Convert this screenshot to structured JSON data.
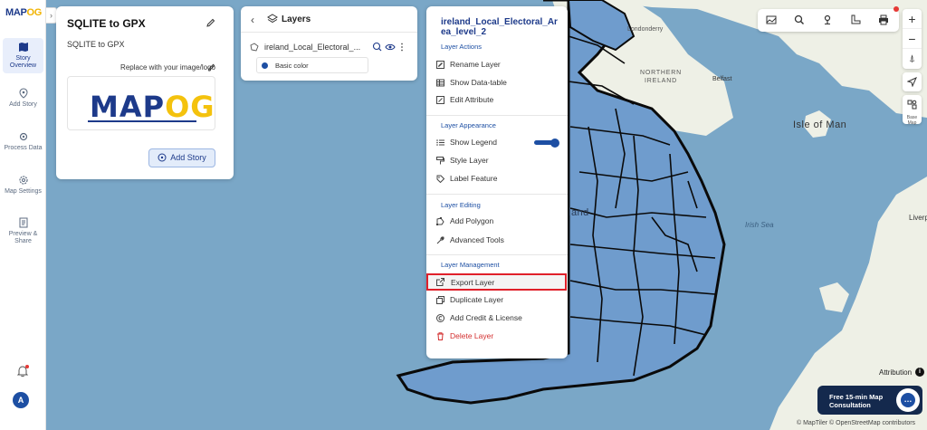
{
  "brand": {
    "logo_map": "MAP",
    "logo_og": "OG"
  },
  "nav": {
    "items": [
      {
        "label": "Story Overview",
        "icon": "map-icon"
      },
      {
        "label": "Add Story",
        "icon": "location-pin-icon"
      },
      {
        "label": "Process Data",
        "icon": "process-gear-icon"
      },
      {
        "label": "Map Settings",
        "icon": "settings-gear-icon"
      },
      {
        "label": "Preview & Share",
        "icon": "preview-icon"
      }
    ],
    "avatar_initial": "A"
  },
  "story": {
    "title": "SQLITE to GPX",
    "subtitle": "SQLITE to GPX",
    "replace_label": "Replace with your image/logo",
    "logo_map": "MAP",
    "logo_og": "OG",
    "add_story_label": "Add Story"
  },
  "layers": {
    "title": "Layers",
    "layer_name": "ireland_Local_Electoral_...",
    "basic_color_label": "Basic color",
    "basic_color": "#1d4fa3"
  },
  "menu": {
    "title": "ireland_Local_Electoral_Area_level_2",
    "sections": {
      "actions": "Layer Actions",
      "appearance": "Layer Appearance",
      "editing": "Layer Editing",
      "management": "Layer Management"
    },
    "items": {
      "rename": "Rename Layer",
      "show_table": "Show Data-table",
      "edit_attribute": "Edit Attribute",
      "show_legend": "Show Legend",
      "style_layer": "Style Layer",
      "label_feature": "Label Feature",
      "add_polygon": "Add Polygon",
      "advanced_tools": "Advanced Tools",
      "export_layer": "Export Layer",
      "duplicate_layer": "Duplicate Layer",
      "add_credit": "Add Credit & License",
      "delete_layer": "Delete Layer"
    },
    "show_legend_on": true
  },
  "map": {
    "labels": {
      "londonderry": "Londonderry",
      "northern": "NORTHERN",
      "ireland_ni": "IRELAND",
      "belfast": "Belfast",
      "isle_of_man": "Isle of Man",
      "irish_sea": "Irish Sea",
      "land": "land",
      "liverp": "Liverp",
      "base_map": "Base Map"
    },
    "attribution_label": "Attribution",
    "copyright": "© MapTiler © OpenStreetMap contributors"
  },
  "consult": {
    "label": "Free 15-min Map Consultation"
  },
  "colors": {
    "accent": "#1d3a8a",
    "highlight_border": "#e0202a",
    "danger": "#d32f2f",
    "sea": "#7aa7c7",
    "land": "#eef0e6"
  }
}
